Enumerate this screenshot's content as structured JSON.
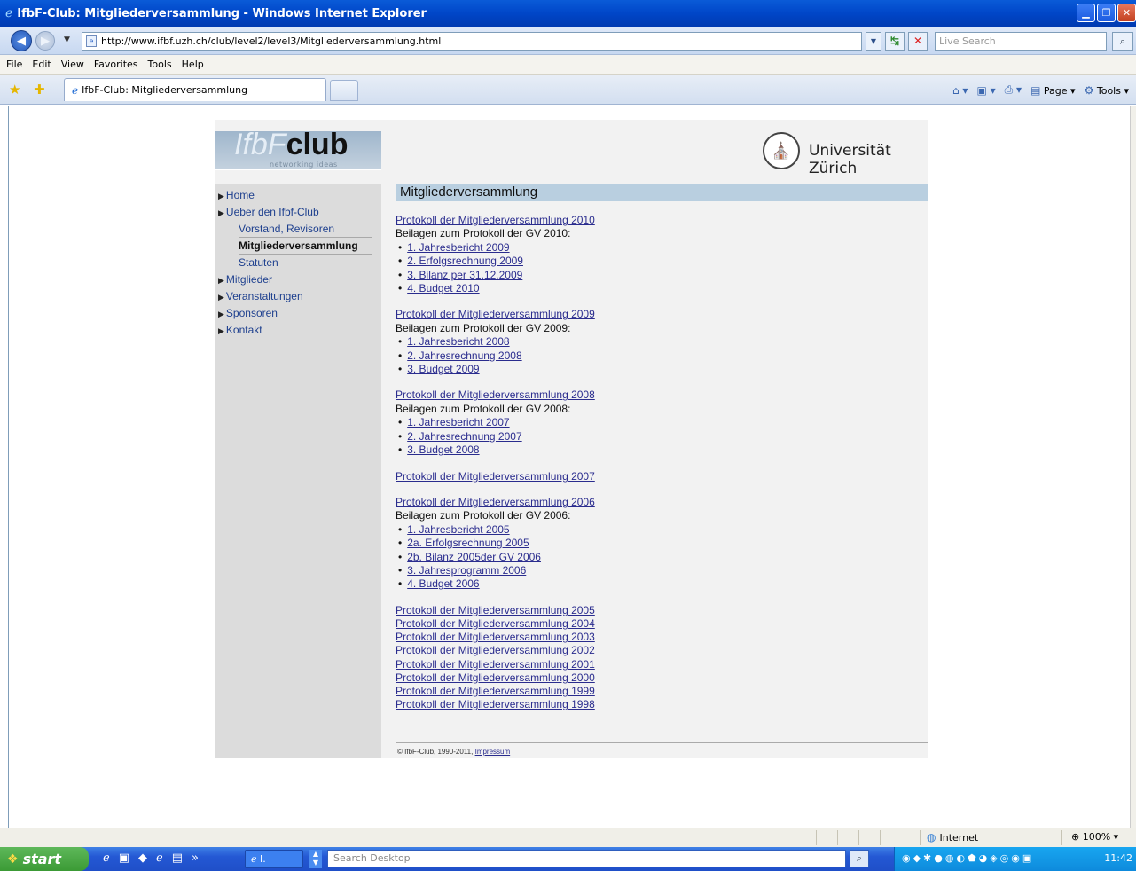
{
  "window": {
    "title": "IfbF-Club: Mitgliederversammlung - Windows Internet Explorer"
  },
  "address": {
    "url": "http://www.ifbf.uzh.ch/club/level2/level3/Mitgliederversammlung.html",
    "search_placeholder": "Live Search"
  },
  "menu": [
    "File",
    "Edit",
    "View",
    "Favorites",
    "Tools",
    "Help"
  ],
  "tab": {
    "title": "IfbF-Club: Mitgliederversammlung"
  },
  "commandbar": {
    "page_label": "Page",
    "tools_label": "Tools"
  },
  "site": {
    "logo_ifbf": "IfbF",
    "logo_club": "club",
    "logo_tagline": "networking ideas",
    "university": "Universität Zürich",
    "sidebar": {
      "home": "Home",
      "ueber": "Ueber den Ifbf-Club",
      "vorstand": "Vorstand, Revisoren",
      "mv": "Mitgliederversammlung",
      "statuten": "Statuten",
      "mitglieder": "Mitglieder",
      "veranstaltungen": "Veranstaltungen",
      "sponsoren": "Sponsoren",
      "kontakt": "Kontakt"
    },
    "heading": "Mitgliederversammlung",
    "blocks": [
      {
        "protocol": "Protokoll der Mitgliederversammlung 2010",
        "attachments_label": "Beilagen zum Protokoll der GV 2010:",
        "items": [
          "1. Jahresbericht 2009",
          "2. Erfolgsrechnung 2009",
          "3. Bilanz per 31.12.2009",
          "4. Budget 2010"
        ]
      },
      {
        "protocol": "Protokoll der Mitgliederversammlung 2009",
        "attachments_label": "Beilagen zum Protokoll der GV 2009:",
        "items": [
          "1. Jahresbericht 2008",
          "2. Jahresrechnung 2008",
          "3. Budget 2009"
        ]
      },
      {
        "protocol": "Protokoll der Mitgliederversammlung 2008",
        "attachments_label": "Beilagen zum Protokoll der GV 2008:",
        "items": [
          "1. Jahresbericht 2007",
          "2. Jahresrechnung 2007",
          "3. Budget 2008"
        ]
      },
      {
        "protocol": "Protokoll der Mitgliederversammlung 2007"
      },
      {
        "protocol": "Protokoll der Mitgliederversammlung 2006",
        "attachments_label": "Beilagen zum Protokoll der GV 2006:",
        "items": [
          "1. Jahresbericht 2005",
          "2a. Erfolgsrechnung 2005",
          "2b. Bilanz 2005der GV 2006",
          "3. Jahresprogramm 2006",
          "4. Budget 2006"
        ]
      }
    ],
    "older_protocols": [
      "Protokoll der Mitgliederversammlung 2005",
      "Protokoll der Mitgliederversammlung 2004",
      "Protokoll der Mitgliederversammlung 2003",
      "Protokoll der Mitgliederversammlung 2002",
      "Protokoll der Mitgliederversammlung 2001",
      "Protokoll der Mitgliederversammlung 2000",
      "Protokoll der Mitgliederversammlung 1999",
      "Protokoll der Mitgliederversammlung 1998"
    ],
    "footer_copyright": "© IfbF-Club, 1990-2011,",
    "footer_impressum": "Impressum"
  },
  "statusbar": {
    "zone": "Internet",
    "zoom": "100%"
  },
  "taskbar": {
    "start": "start",
    "task_ie": "I.",
    "search_placeholder": "Search Desktop",
    "clock": "11:42"
  }
}
